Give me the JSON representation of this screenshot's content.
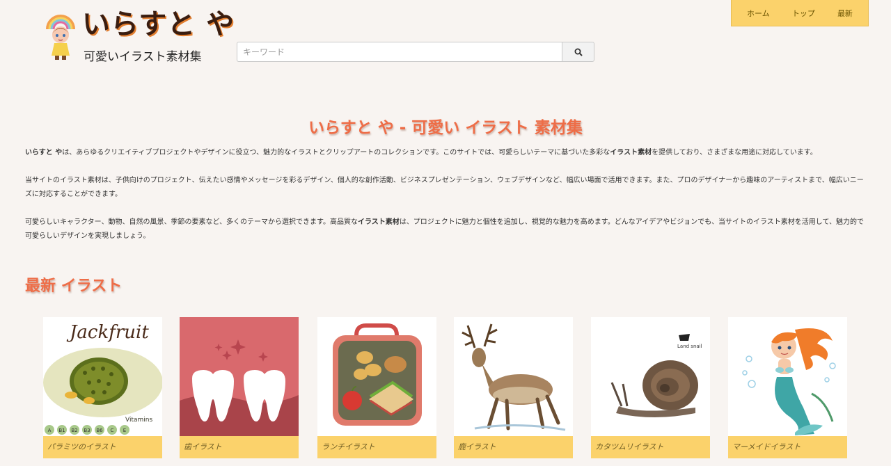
{
  "header": {
    "logo_title": "いらすと や",
    "logo_subtitle": "可愛いイラスト素材集"
  },
  "search": {
    "placeholder": "キーワード",
    "button_icon": "search-icon"
  },
  "nav": {
    "items": [
      "ホーム",
      "トップ",
      "最新"
    ]
  },
  "intro": {
    "heading": "いらすと や - 可愛い イラスト 素材集",
    "p1_lead": "いらすと や",
    "p1_a": "は、あらゆるクリエイティブプロジェクトやデザインに役立つ、魅力的なイラストとクリップアートのコレクションです。このサイトでは、可愛らしいテーマに基づいた多彩な",
    "p1_bold": "イラスト素材",
    "p1_b": "を提供しており、さまざまな用途に対応しています。",
    "p2": "当サイトのイラスト素材は、子供向けのプロジェクト、伝えたい感情やメッセージを彩るデザイン、個人的な創作活動、ビジネスプレゼンテーション、ウェブデザインなど、幅広い場面で活用できます。また、プロのデザイナーから趣味のアーティストまで、幅広いニーズに対応することができます。",
    "p3_a": "可愛らしいキャラクター、動物、自然の風景、季節の要素など、多くのテーマから選択できます。高品質な",
    "p3_bold": "イラスト素材",
    "p3_b": "は、プロジェクトに魅力と個性を追加し、視覚的な魅力を高めます。どんなアイデアやビジョンでも、当サイトのイラスト素材を活用して、魅力的で可愛らしいデザインを実現しましょう。"
  },
  "latest": {
    "heading": "最新 イラスト",
    "cards": [
      {
        "caption": "パラミツのイラスト",
        "img_title": "Jackfruit",
        "img_note": "Vitamins",
        "vitamins": [
          "A",
          "B1",
          "B2",
          "B3",
          "B6",
          "C",
          "E"
        ]
      },
      {
        "caption": "歯イラスト"
      },
      {
        "caption": "ランチイラスト"
      },
      {
        "caption": "鹿イラスト"
      },
      {
        "caption": "カタツムリイラスト",
        "img_note": "Land snail"
      },
      {
        "caption": "マーメイドイラスト"
      }
    ]
  },
  "colors": {
    "accent": "#ee6d47",
    "nav_bg": "#fbd26b",
    "caption_bg": "#fbd26b",
    "page_bg": "#f8f4f1"
  }
}
